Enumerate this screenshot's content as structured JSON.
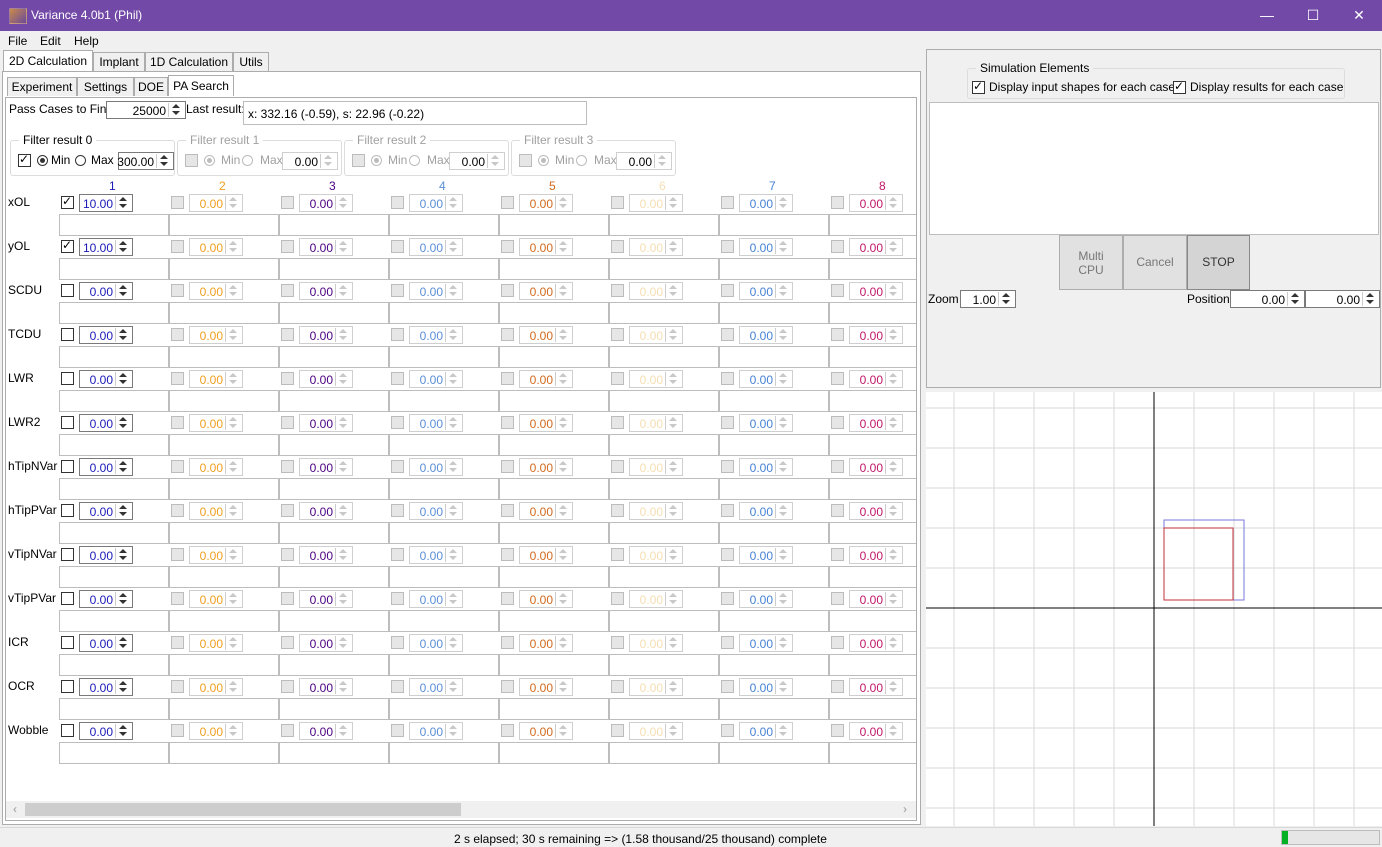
{
  "window": {
    "title": "Variance 4.0b1 (Phil)",
    "minimize": "—",
    "maximize": "☐",
    "close": "✕"
  },
  "menu": [
    "File",
    "Edit",
    "Help"
  ],
  "main_tabs": [
    "2D Calculation",
    "Implant",
    "1D Calculation",
    "Utils"
  ],
  "sub_tabs": [
    "Experiment",
    "Settings",
    "DOE",
    "PA Search"
  ],
  "pa_search": {
    "pass_cases_label": "Pass Cases to Find",
    "pass_cases_value": "25000",
    "last_result_label": "Last result:",
    "last_result_value": "x: 332.16 (-0.59), s: 22.96 (-0.22)"
  },
  "filters": [
    {
      "title": "Filter result 0",
      "checked": true,
      "min_label": "Min",
      "max_label": "Max",
      "value": "300.00",
      "enabled": true
    },
    {
      "title": "Filter result 1",
      "checked": false,
      "min_label": "Min",
      "max_label": "Max",
      "value": "0.00",
      "enabled": false
    },
    {
      "title": "Filter result 2",
      "checked": false,
      "min_label": "Min",
      "max_label": "Max",
      "value": "0.00",
      "enabled": false
    },
    {
      "title": "Filter result 3",
      "checked": false,
      "min_label": "Min",
      "max_label": "Max",
      "value": "0.00",
      "enabled": false
    }
  ],
  "columns": [
    {
      "label": "1",
      "color": "#1a1ab8"
    },
    {
      "label": "2",
      "color": "#f0a020"
    },
    {
      "label": "3",
      "color": "#4b0082"
    },
    {
      "label": "4",
      "color": "#5a8fd6"
    },
    {
      "label": "5",
      "color": "#d2691e"
    },
    {
      "label": "6",
      "color": "#f5deb3"
    },
    {
      "label": "7",
      "color": "#4682d4"
    },
    {
      "label": "8",
      "color": "#c0186a"
    }
  ],
  "rows": [
    {
      "label": "xOL",
      "checked": true,
      "first": "10.00"
    },
    {
      "label": "yOL",
      "checked": true,
      "first": "10.00"
    },
    {
      "label": "SCDU",
      "checked": false,
      "first": "0.00"
    },
    {
      "label": "TCDU",
      "checked": false,
      "first": "0.00"
    },
    {
      "label": "LWR",
      "checked": false,
      "first": "0.00"
    },
    {
      "label": "LWR2",
      "checked": false,
      "first": "0.00"
    },
    {
      "label": "hTipNVar",
      "checked": false,
      "first": "0.00"
    },
    {
      "label": "hTipPVar",
      "checked": false,
      "first": "0.00"
    },
    {
      "label": "vTipNVar",
      "checked": false,
      "first": "0.00"
    },
    {
      "label": "vTipPVar",
      "checked": false,
      "first": "0.00"
    },
    {
      "label": "ICR",
      "checked": false,
      "first": "0.00"
    },
    {
      "label": "OCR",
      "checked": false,
      "first": "0.00"
    },
    {
      "label": "Wobble",
      "checked": false,
      "first": "0.00"
    }
  ],
  "other_value": "0.00",
  "simulation": {
    "group_title": "Simulation Elements",
    "display_input": "Display input shapes for each case",
    "display_results": "Display results for each case",
    "multi_cpu_line1": "Multi",
    "multi_cpu_line2": "CPU",
    "cancel": "Cancel",
    "stop": "STOP",
    "zoom_label": "Zoom",
    "zoom_value": "1.00",
    "position_label": "Position",
    "position_x": "0.00",
    "position_y": "0.00"
  },
  "status": {
    "text": "2 s elapsed; 30 s remaining => (1.58 thousand/25 thousand) complete",
    "progress": 0.063
  },
  "colors": {
    "title_bar": "#7349a8",
    "shape_input": "#7777dd",
    "shape_result": "#c0303a",
    "progress": "#06b025"
  }
}
